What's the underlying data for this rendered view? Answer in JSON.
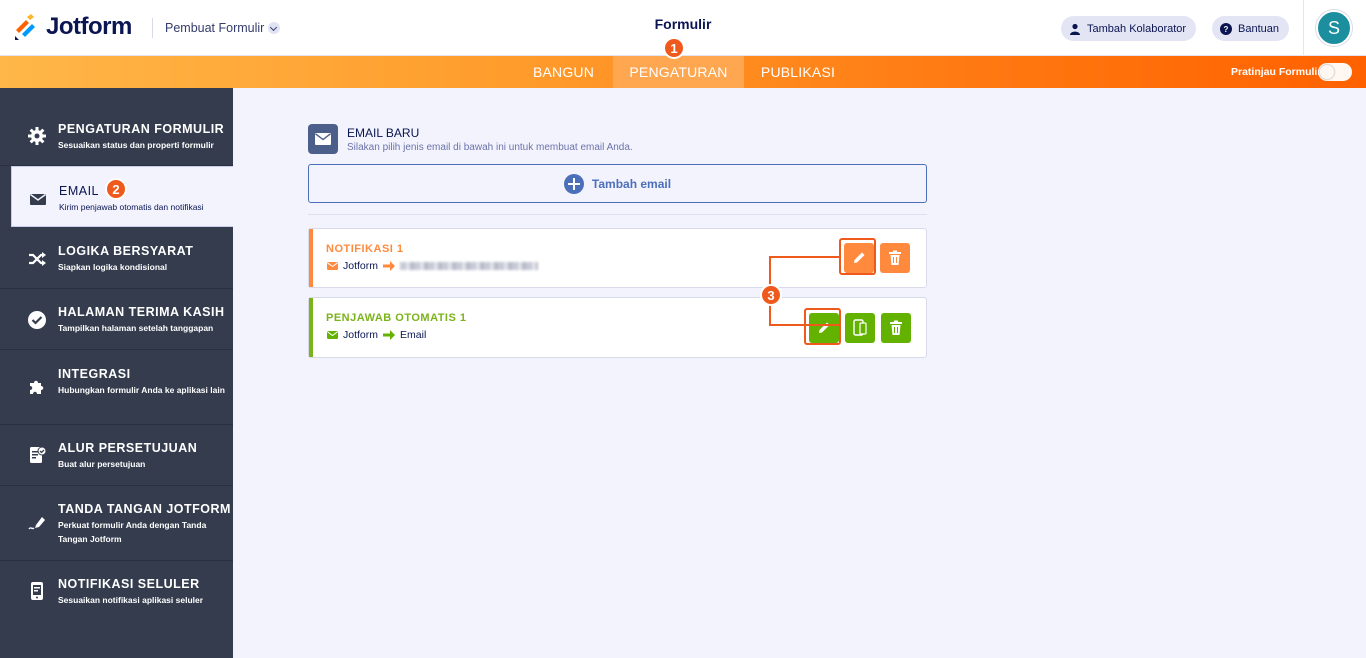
{
  "header": {
    "logo_text": "Jotform",
    "builder_menu": "Pembuat Formulir",
    "title": "Formulir",
    "collab_button": "Tambah Kolaborator",
    "help_button": "Bantuan",
    "avatar_initial": "S"
  },
  "nav": {
    "tabs": [
      {
        "label": "BANGUN",
        "active": false
      },
      {
        "label": "PENGATURAN",
        "active": true
      },
      {
        "label": "PUBLIKASI",
        "active": false
      }
    ],
    "preview_label": "Pratinjau Formulir"
  },
  "badges": [
    "1",
    "2",
    "3"
  ],
  "sidebar": {
    "items": [
      {
        "title": "PENGATURAN FORMULIR",
        "desc": "Sesuaikan status dan properti formulir",
        "icon": "gear-icon"
      },
      {
        "title": "EMAIL",
        "desc": "Kirim penjawab otomatis dan notifikasi",
        "icon": "envelope-icon",
        "active": true
      },
      {
        "title": "LOGIKA BERSYARAT",
        "desc": "Siapkan logika kondisional",
        "icon": "shuffle-icon"
      },
      {
        "title": "HALAMAN TERIMA KASIH",
        "desc": "Tampilkan halaman setelah tanggapan",
        "icon": "check-circle-icon"
      },
      {
        "title": "INTEGRASI",
        "desc": "Hubungkan formulir Anda ke aplikasi lain",
        "icon": "puzzle-icon"
      },
      {
        "title": "ALUR PERSETUJUAN",
        "desc": "Buat alur persetujuan",
        "icon": "approval-doc-icon"
      },
      {
        "title": "TANDA TANGAN JOTFORM",
        "desc": "Perkuat formulir Anda dengan Tanda Tangan Jotform",
        "icon": "pen-signature-icon"
      },
      {
        "title": "NOTIFIKASI SELULER",
        "desc": "Sesuaikan notifikasi aplikasi seluler",
        "icon": "mobile-notification-icon"
      }
    ]
  },
  "main": {
    "new_email_title": "EMAIL BARU",
    "new_email_desc": "Silakan pilih jenis email di bawah ini untuk membuat email Anda.",
    "add_email_label": "Tambah email",
    "cards": [
      {
        "title": "NOTIFIKASI 1",
        "from": "Jotform",
        "to": "",
        "accent": "#ff8a3d"
      },
      {
        "title": "PENJAWAB OTOMATIS 1",
        "from": "Jotform",
        "to": "Email",
        "accent": "#7bb31a"
      }
    ]
  },
  "colors": {
    "orange": "#ff8a3d",
    "green": "#64b200",
    "sidebar_bg": "#343c4e",
    "badge": "#ef5a1c",
    "navy": "#0a1551"
  }
}
